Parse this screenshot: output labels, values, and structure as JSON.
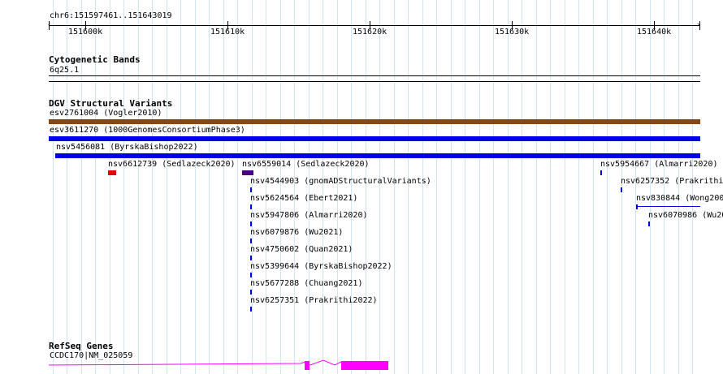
{
  "ruler": {
    "location": "chr6:151597461..151643019",
    "ticks": [
      "151600k",
      "151610k",
      "151620k",
      "151630k",
      "151640k"
    ]
  },
  "cytoband": {
    "title": "Cytogenetic Bands",
    "band": "6q25.1"
  },
  "dgv": {
    "title": "DGV Structural Variants",
    "features": [
      {
        "label": "esv2761004 (Vogler2010)",
        "color": "#8b4513"
      },
      {
        "label": "esv3611270 (1000GenomesConsortiumPhase3)",
        "color": "#0000e6"
      },
      {
        "label": "nsv5456081 (ByrskaBishop2022)",
        "color": "#0000e6"
      },
      {
        "label": "nsv6612739 (Sedlazeck2020)",
        "color": "#e60000"
      },
      {
        "label": "nsv6559014 (Sedlazeck2020)",
        "color": "#4b0082"
      },
      {
        "label": "nsv4544903 (gnomADStructuralVariants)",
        "color": "#0000e6"
      },
      {
        "label": "nsv5624564 (Ebert2021)",
        "color": "#0000e6"
      },
      {
        "label": "nsv5947806 (Almarri2020)",
        "color": "#0000e6"
      },
      {
        "label": "nsv6079876 (Wu2021)",
        "color": "#0000e6"
      },
      {
        "label": "nsv4750602 (Quan2021)",
        "color": "#0000e6"
      },
      {
        "label": "nsv5399644 (ByrskaBishop2022)",
        "color": "#0000e6"
      },
      {
        "label": "nsv5677288 (Chuang2021)",
        "color": "#0000e6"
      },
      {
        "label": "nsv6257351 (Prakrithi2022)",
        "color": "#0000e6"
      },
      {
        "label": "nsv5954667 (Almarri2020)",
        "color": "#0000e6"
      },
      {
        "label": "nsv6257352 (Prakrithi",
        "color": "#0000e6"
      },
      {
        "label": "nsv830844 (Wong200",
        "color": "#0000e6"
      },
      {
        "label": "nsv6070986 (Wu20",
        "color": "#0000e6"
      }
    ]
  },
  "refseq": {
    "title": "RefSeq Genes",
    "gene": "CCDC170|NM_025059",
    "color": "#ff00ff"
  },
  "colors": {
    "grid": "#cfe7f3"
  }
}
